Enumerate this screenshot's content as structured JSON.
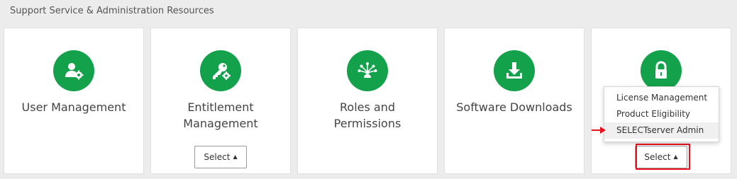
{
  "section_title": "Support Service & Administration Resources",
  "cards": [
    {
      "label": "User Management",
      "icon": "user-gear-icon"
    },
    {
      "label": "Entitlement Management",
      "icon": "key-gear-icon",
      "select_label": "Select"
    },
    {
      "label": "Roles and Permissions",
      "icon": "network-people-icon"
    },
    {
      "label": "Software Downloads",
      "icon": "download-icon"
    },
    {
      "label": "",
      "icon": "lock-icon",
      "select_label": "Select"
    }
  ],
  "dropdown": {
    "items": [
      "License Management",
      "Product Eligibility",
      "SELECTserver Admin"
    ],
    "active_index": 2
  },
  "colors": {
    "accent_green": "#13a14b",
    "highlight_red": "#e8111b"
  }
}
